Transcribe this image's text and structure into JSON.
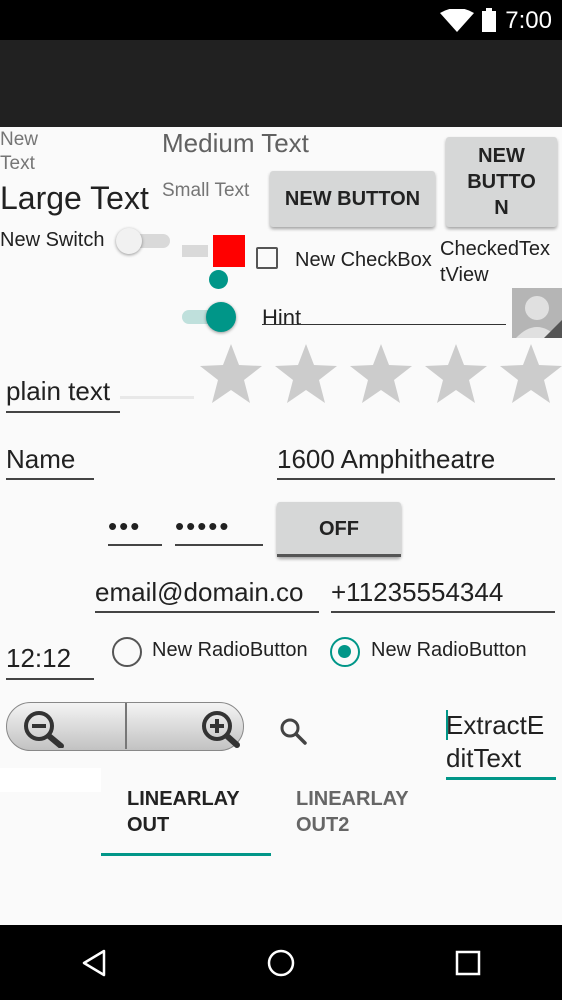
{
  "status": {
    "time": "7:00"
  },
  "texts": {
    "small_text_top": "New\nText",
    "medium_text": "Medium Text",
    "large_text": "Large Text",
    "small_text": "Small Text",
    "switch_label": "New Switch",
    "checkbox_label": "New CheckBox",
    "checked_text_view": "CheckedTex\ntView"
  },
  "buttons": {
    "new_button": "NEW BUTTON",
    "new_button_narrow": "NEW\nBUTTO\nN",
    "toggle_off": "OFF"
  },
  "inputs": {
    "hint": "Hint",
    "plain_text": "plain text",
    "name": "Name",
    "address": "1600 Amphitheatre",
    "password1": "•••",
    "password2": "•••••",
    "email": "email@domain.co",
    "phone": "+11235554344",
    "time": "12:12",
    "extract_edit": "ExtractE\nditText"
  },
  "radios": [
    {
      "label": "New RadioButton",
      "checked": false
    },
    {
      "label": "New RadioButton",
      "checked": true
    }
  ],
  "rating": {
    "stars": 5,
    "value": 0
  },
  "tabs": [
    {
      "label": "LINEARLAY\nOUT",
      "selected": true
    },
    {
      "label": "LINEARLAY\nOUT2",
      "selected": false
    }
  ],
  "colors": {
    "accent": "#009688",
    "red_square": "#ff0000",
    "star": "#cccccc"
  }
}
